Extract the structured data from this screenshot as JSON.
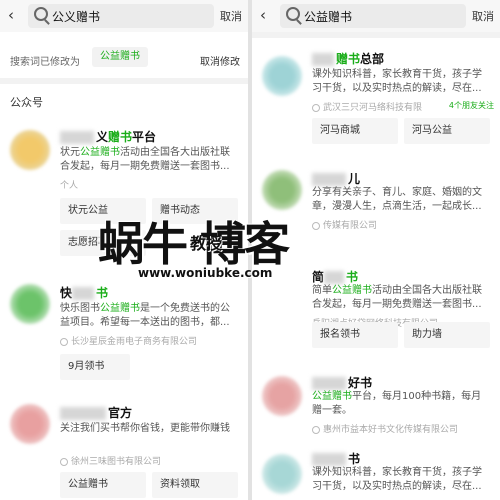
{
  "left": {
    "back": "‹",
    "query": "公义赠书",
    "cancel": "取消",
    "modify": {
      "prefix": "搜索词已修改为",
      "keyword": "公益赠书",
      "cancel": "取消修改"
    },
    "section": "公众号",
    "cards": [
      {
        "name_suffix": "义",
        "name_hl": "赠书",
        "name_tail": "平台",
        "desc_pre": "状元",
        "desc_hl": "公益赠书",
        "desc_post": "活动由全国各大出版社联合发起，每月一期免费赠送一套图书...",
        "meta": "个人",
        "buttons": [
          "状元公益",
          "赠书动态",
          "志愿招募"
        ]
      },
      {
        "name_prefix": "快",
        "name_hl": "书",
        "desc_pre": "快乐图书",
        "desc_hl": "公益赠书",
        "desc_post": "是一个免费送书的公益项目。希望每一本送出的图书，都...",
        "meta": "长沙星辰金雨电子商务有限公司",
        "buttons": [
          "9月领书"
        ]
      },
      {
        "name_tail": "官方",
        "desc_pre": "关注我们",
        "desc_hl": "",
        "desc_post": "买书帮你省钱，更能带你赚钱",
        "meta": "徐州三味图书有限公司",
        "buttons": [
          "公益赠书",
          "资料领取"
        ]
      }
    ]
  },
  "right": {
    "back": "‹",
    "query": "公益赠书",
    "cancel": "取消",
    "cards": [
      {
        "name_hl": "赠书",
        "name_tail": "总部",
        "desc": "课外知识科普，家长教育干货，孩子学习干货，以及实时热点的解读，尽在...",
        "meta": "武汉三只河马络科技有限",
        "friends": "4个朋友关注",
        "buttons": [
          "河马商城",
          "河马公益"
        ]
      },
      {
        "name_tail": "儿",
        "desc": "分享有关亲子、育儿、家庭、婚姻的文章，漫漫人生，点滴生活，一起成长...",
        "meta": "传媒有限公司",
        "buttons": []
      },
      {
        "name_pre": "简",
        "name_hl": "书",
        "desc_pre": "简单",
        "desc_hl": "公益赠书",
        "desc_post": "活动由全国各大出版社联合发起，每月一期免费赠送一套图书...",
        "meta": "岳阳湘点好贷网络科技有限公司",
        "buttons": [
          "报名领书",
          "助力墙"
        ]
      },
      {
        "name_tail": "好书",
        "desc_hl": "公益赠书",
        "desc_post": "平台，每月100种书籍，每月赠一套。",
        "meta": "惠州市益本好书文化传媒有限公司",
        "buttons": []
      },
      {
        "name_tail": "书",
        "desc": "课外知识科普，家长教育干货，孩子学习干货，以及实时热点的解读，尽在...",
        "meta": "",
        "buttons": []
      }
    ]
  },
  "watermark": {
    "big": "蜗牛    博客",
    "small": "教授",
    "url": "www.woniubke.com"
  },
  "colors": {
    "accent": "#1aad19",
    "bg": "#ededed"
  }
}
